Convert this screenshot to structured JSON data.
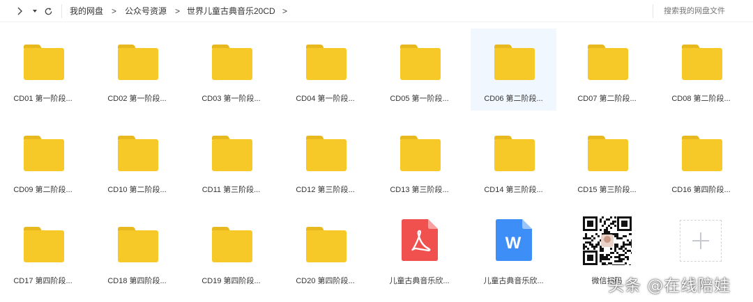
{
  "nav": {
    "forward_icon": "chevron-right-icon",
    "history_icon": "caret-down-icon",
    "refresh_icon": "refresh-icon"
  },
  "breadcrumb": {
    "items": [
      "我的网盘",
      "公众号资源",
      "世界儿童古典音乐20CD"
    ],
    "separator": ">"
  },
  "search": {
    "placeholder": "搜索我的网盘文件"
  },
  "colors": {
    "folder_body": "#f7c928",
    "folder_tab": "#e8b81f",
    "pdf": "#f0504e",
    "word": "#3e8ef7",
    "hover_bg": "#f0f7fe"
  },
  "files": [
    {
      "name": "CD01 第一阶段...",
      "type": "folder"
    },
    {
      "name": "CD02 第一阶段...",
      "type": "folder"
    },
    {
      "name": "CD03 第一阶段...",
      "type": "folder"
    },
    {
      "name": "CD04 第一阶段...",
      "type": "folder"
    },
    {
      "name": "CD05 第一阶段...",
      "type": "folder"
    },
    {
      "name": "CD06 第二阶段...",
      "type": "folder",
      "selected": true
    },
    {
      "name": "CD07 第二阶段...",
      "type": "folder"
    },
    {
      "name": "CD08 第二阶段...",
      "type": "folder"
    },
    {
      "name": "CD09 第二阶段...",
      "type": "folder"
    },
    {
      "name": "CD10 第二阶段...",
      "type": "folder"
    },
    {
      "name": "CD11 第三阶段...",
      "type": "folder"
    },
    {
      "name": "CD12 第三阶段...",
      "type": "folder"
    },
    {
      "name": "CD13 第三阶段...",
      "type": "folder"
    },
    {
      "name": "CD14 第三阶段...",
      "type": "folder"
    },
    {
      "name": "CD15 第三阶段...",
      "type": "folder"
    },
    {
      "name": "CD16 第四阶段...",
      "type": "folder"
    },
    {
      "name": "CD17 第四阶段...",
      "type": "folder"
    },
    {
      "name": "CD18 第四阶段...",
      "type": "folder"
    },
    {
      "name": "CD19 第四阶段...",
      "type": "folder"
    },
    {
      "name": "CD20 第四阶段...",
      "type": "folder"
    },
    {
      "name": "儿童古典音乐欣...",
      "type": "pdf"
    },
    {
      "name": "儿童古典音乐欣...",
      "type": "word",
      "glyph": "W"
    },
    {
      "name": "微信扫码",
      "type": "qr"
    },
    {
      "name": "",
      "type": "add"
    }
  ],
  "watermark": "头条 @在线陪娃"
}
